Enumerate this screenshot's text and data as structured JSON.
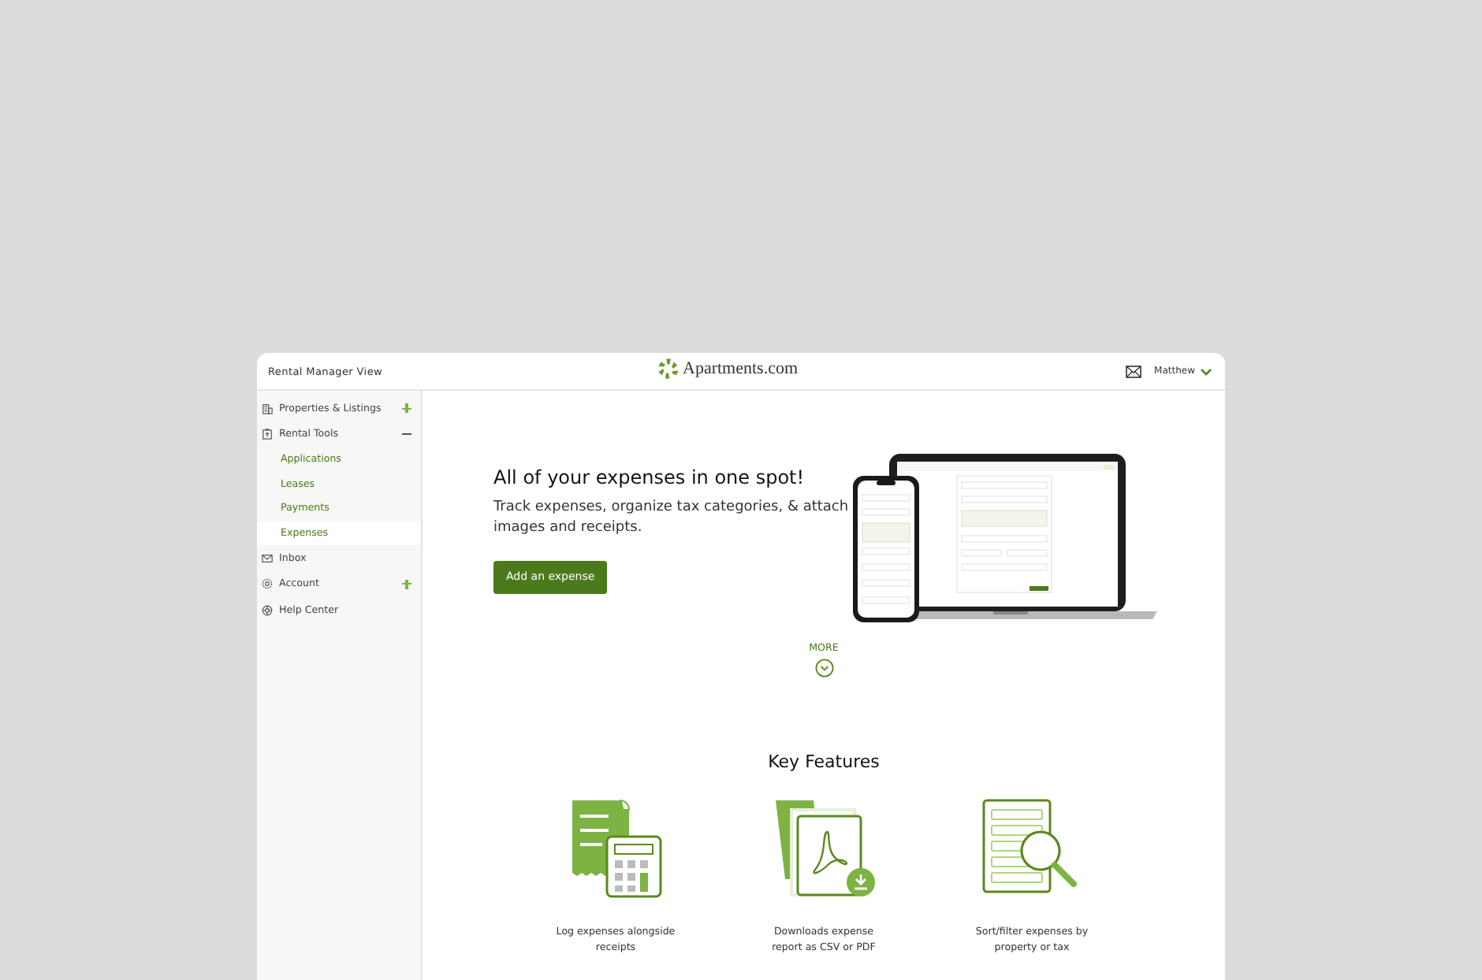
{
  "header": {
    "title": "Rental Manager View",
    "logo": "Apartments.com",
    "user": "Matthew"
  },
  "sidebar": {
    "items": [
      {
        "label": "Properties & Listings",
        "kind": "group",
        "expanded": false
      },
      {
        "label": "Rental Tools",
        "kind": "group",
        "expanded": true,
        "children": [
          {
            "label": "Applications",
            "selected": false
          },
          {
            "label": "Leases",
            "selected": false
          },
          {
            "label": "Payments",
            "selected": false
          },
          {
            "label": "Expenses",
            "selected": true
          }
        ]
      },
      {
        "label": "Inbox",
        "kind": "link"
      },
      {
        "label": "Account",
        "kind": "group",
        "expanded": false
      },
      {
        "label": "Help Center",
        "kind": "link"
      }
    ]
  },
  "hero": {
    "title": "All of your expenses in one spot!",
    "description": "Track expenses, organize tax categories, & attach images and receipts.",
    "button": "Add an expense"
  },
  "more": "MORE",
  "features": {
    "title": "Key Features",
    "items": [
      {
        "kind": "receipt",
        "caption": "Log expenses alongside receipts"
      },
      {
        "kind": "pdf",
        "caption": "Downloads expense report as CSV or PDF"
      },
      {
        "kind": "filter",
        "caption": "Sort/filter expenses by property or tax"
      }
    ]
  }
}
